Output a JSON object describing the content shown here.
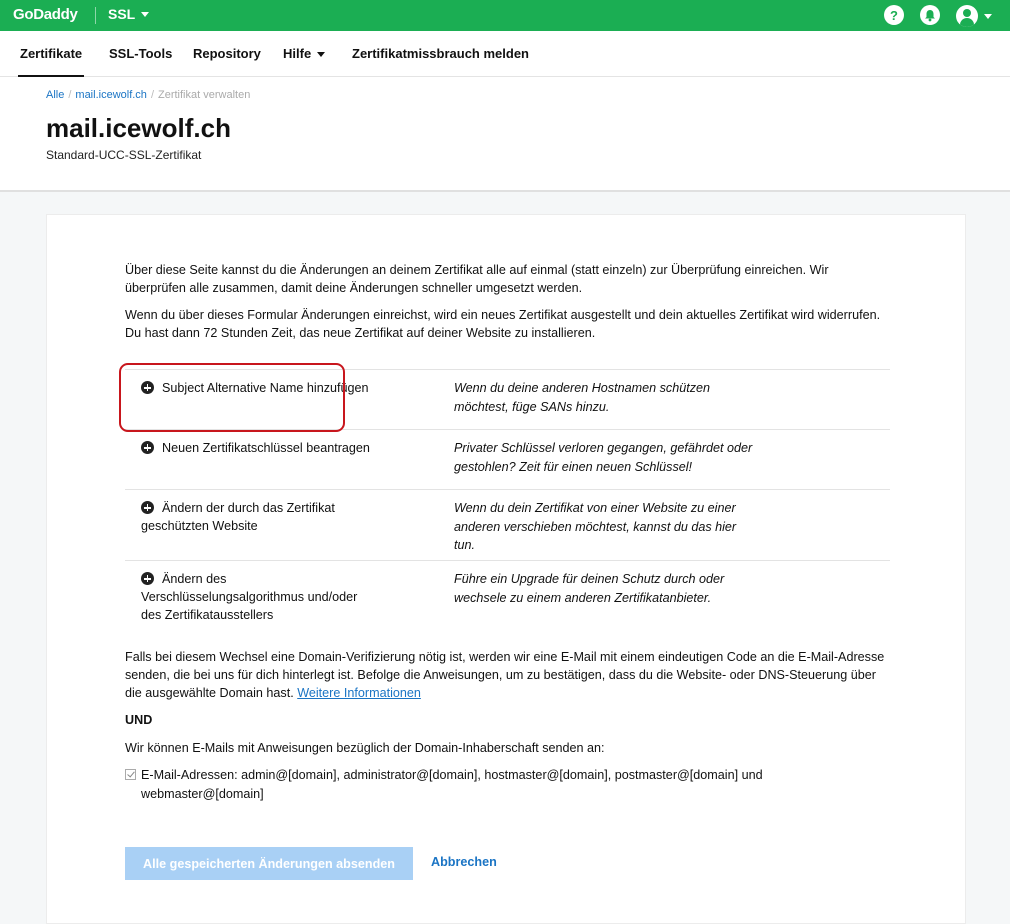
{
  "topbar": {
    "brand": "GoDaddy",
    "product": "SSL",
    "help_icon": "help-icon",
    "bell_icon": "bell-icon",
    "user_icon": "user-icon",
    "color": "#1bae53"
  },
  "nav": {
    "items": [
      {
        "label": "Zertifikate",
        "active": true
      },
      {
        "label": "SSL-Tools"
      },
      {
        "label": "Repository"
      },
      {
        "label": "Hilfe"
      },
      {
        "label": "Zertifikatmissbrauch melden"
      }
    ]
  },
  "breadcrumb": {
    "items": [
      "Alle",
      "mail.icewolf.ch",
      "Zertifikat verwalten"
    ]
  },
  "header": {
    "title": "mail.icewolf.ch",
    "subtitle": "Standard-UCC-SSL-Zertifikat"
  },
  "intro": {
    "p1": "Über diese Seite kannst du die Änderungen an deinem Zertifikat alle auf einmal (statt einzeln) zur Überprüfung einreichen. Wir überprüfen alle zusammen, damit deine Änderungen schneller umgesetzt werden.",
    "p2": "Wenn du über dieses Formular Änderungen einreichst, wird ein neues Zertifikat ausgestellt und dein aktuelles Zertifikat wird widerrufen. Du hast dann 72 Stunden Zeit, das neue Zertifikat auf deiner Website zu installieren."
  },
  "options": [
    {
      "title": "Subject Alternative Name hinzufügen",
      "desc": "Wenn du deine anderen Hostnamen schützen möchtest, füge SANs hinzu."
    },
    {
      "title": "Neuen Zertifikatschlüssel beantragen",
      "desc": "Privater Schlüssel verloren gegangen, gefährdet oder gestohlen? Zeit für einen neuen Schlüssel!"
    },
    {
      "title": "Ändern der durch das Zertifikat geschützten Website",
      "desc": "Wenn du dein Zertifikat von einer Website zu einer anderen verschieben möchtest, kannst du das hier tun."
    },
    {
      "title": "Ändern des Verschlüsselungsalgorithmus und/oder des Zertifikatausstellers",
      "desc": "Führe ein Upgrade für deinen Schutz durch oder wechsele zu einem anderen Zertifikatanbieter."
    }
  ],
  "verification": {
    "text": "Falls bei diesem Wechsel eine Domain-Verifizierung nötig ist, werden wir eine E-Mail mit einem eindeutigen Code an die E-Mail-Adresse senden, die bei uns für dich hinterlegt ist. Befolge die Anweisungen, um zu bestätigen, dass du die Website- oder DNS-Steuerung über die ausgewählte Domain hast.",
    "link": "Weitere Informationen"
  },
  "und": "UND",
  "email_intro": "Wir können E-Mails mit Anweisungen bezüglich der Domain-Inhaberschaft senden an:",
  "email_checkbox": {
    "label": "E-Mail-Adressen: admin@[domain], administrator@[domain], hostmaster@[domain], postmaster@[domain] und webmaster@[domain]",
    "checked": true
  },
  "actions": {
    "submit": "Alle gespeicherten Änderungen absenden",
    "cancel": "Abbrechen"
  }
}
